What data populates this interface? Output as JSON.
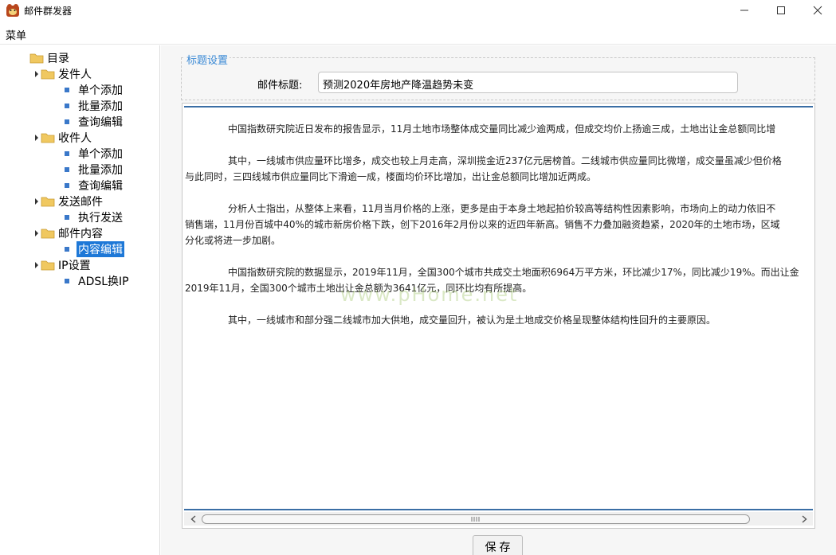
{
  "window": {
    "title": "邮件群发器"
  },
  "menu": {
    "label": "菜单"
  },
  "tree": {
    "root": "目录",
    "groups": [
      {
        "label": "发件人",
        "items": [
          "单个添加",
          "批量添加",
          "查询编辑"
        ]
      },
      {
        "label": "收件人",
        "items": [
          "单个添加",
          "批量添加",
          "查询编辑"
        ]
      },
      {
        "label": "发送邮件",
        "items": [
          "执行发送"
        ]
      },
      {
        "label": "邮件内容",
        "items": [
          "内容编辑"
        ]
      },
      {
        "label": "IP设置",
        "items": [
          "ADSL换IP"
        ]
      }
    ],
    "selected": "内容编辑"
  },
  "subject_group": {
    "title": "标题设置",
    "label": "邮件标题:",
    "value": "预测2020年房地产降温趋势未变"
  },
  "content": {
    "paragraphs": [
      [
        "中国指数研究院近日发布的报告显示，11月土地市场整体成交量同比减少逾两成，但成交均价上扬逾三成，土地出让金总额同比增"
      ],
      [
        "其中，一线城市供应量环比增多，成交也较上月走高，深圳揽金近237亿元居榜首。二线城市供应量同比微增，成交量虽减少但价格",
        "与此同时，三四线城市供应量同比下滑逾一成，楼面均价环比增加，出让金总额同比增加近两成。"
      ],
      [
        "分析人士指出，从整体上来看，11月当月价格的上涨，更多是由于本身土地起拍价较高等结构性因素影响，市场向上的动力依旧不",
        "销售端，11月份百城中40%的城市新房价格下跌，创下2016年2月份以来的近四年新高。销售不力叠加融资趋紧，2020年的土地市场，区域",
        "分化或将进一步加剧。"
      ],
      [
        "中国指数研究院的数据显示，2019年11月，全国300个城市共成交土地面积6964万平方米，环比减少17%，同比减少19%。而出让金",
        "2019年11月，全国300个城市土地出让金总额为3641亿元，同环比均有所提高。"
      ],
      [
        "其中，一线城市和部分强二线城市加大供地，成交量回升，被认为是土地成交价格呈现整体结构性回升的主要原因。"
      ]
    ],
    "watermark": "www.pHome.net"
  },
  "buttons": {
    "save": "保存"
  },
  "colors": {
    "accent": "#3a89d5",
    "selection": "#1e78d7",
    "rule": "#3a6ea5"
  }
}
